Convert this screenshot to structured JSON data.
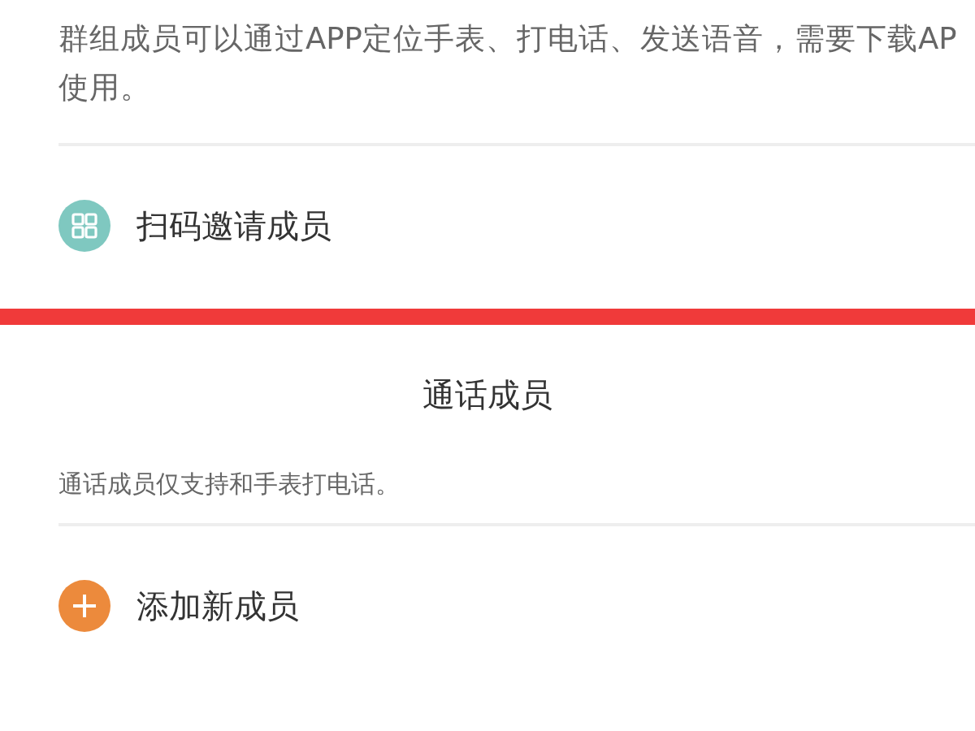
{
  "group_section": {
    "description": "群组成员可以通过APP定位手表、打电话、发送语音，需要下载AP\n使用。",
    "action": {
      "kind": "qr",
      "label": "扫码邀请成员"
    }
  },
  "call_section": {
    "title": "通话成员",
    "description": "通话成员仅支持和手表打电话。",
    "action": {
      "kind": "add",
      "label": "添加新成员"
    }
  }
}
